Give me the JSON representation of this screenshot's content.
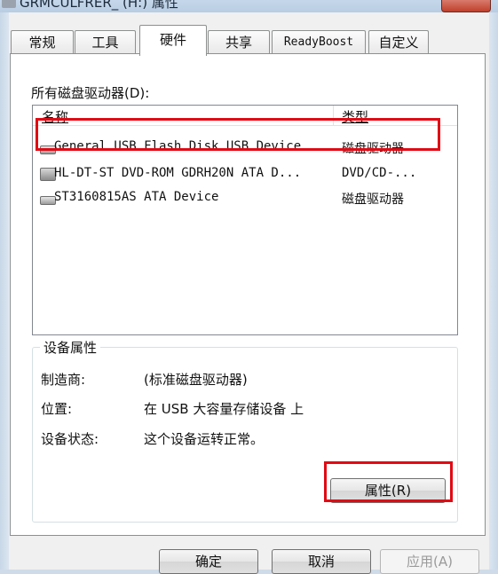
{
  "window": {
    "title": "GRMCULFRER_ (H:) 属性"
  },
  "tabs": [
    {
      "label": "常规"
    },
    {
      "label": "工具"
    },
    {
      "label": "硬件"
    },
    {
      "label": "共享"
    },
    {
      "label": "ReadyBoost"
    },
    {
      "label": "自定义"
    }
  ],
  "hardware": {
    "all_drives_label": "所有磁盘驱动器(D):",
    "columns": {
      "name": "名称",
      "type": "类型"
    },
    "drives": [
      {
        "name": "General USB Flash Disk USB Device",
        "type": "磁盘驱动器",
        "icon": "usb-drive-icon"
      },
      {
        "name": "HL-DT-ST DVD-ROM GDRH20N ATA D...",
        "type": "DVD/CD-...",
        "icon": "optical-drive-icon"
      },
      {
        "name": "ST3160815AS ATA Device",
        "type": "磁盘驱动器",
        "icon": "hard-disk-icon"
      }
    ]
  },
  "device_properties": {
    "group_title": "设备属性",
    "manufacturer_label": "制造商:",
    "manufacturer_value": "(标准磁盘驱动器)",
    "location_label": "位置:",
    "location_value": "在 USB 大容量存储设备 上",
    "status_label": "设备状态:",
    "status_value": "这个设备运转正常。",
    "properties_button": "属性(R)"
  },
  "buttons": {
    "ok": "确定",
    "cancel": "取消",
    "apply": "应用(A)"
  },
  "colors": {
    "highlight": "#e10a14"
  }
}
